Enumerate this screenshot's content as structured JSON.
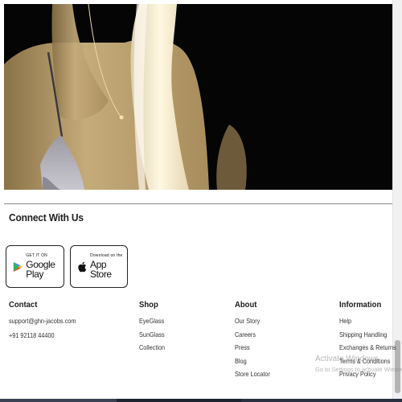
{
  "connect": {
    "title": "Connect With Us"
  },
  "badges": {
    "google": {
      "small": "GET IT ON",
      "big": "Google Play"
    },
    "apple": {
      "small": "Download on the",
      "big": "App Store"
    }
  },
  "footer": {
    "contact": {
      "heading": "Contact",
      "email": "support@ghn-jacobs.com",
      "phone": "+91 92118 44400"
    },
    "shop": {
      "heading": "Shop",
      "links": [
        "EyeGlass",
        "SunGlass",
        "Collection"
      ]
    },
    "about": {
      "heading": "About",
      "links": [
        "Our Story",
        "Careers",
        "Press",
        "Blog",
        "Store Locator"
      ]
    },
    "information": {
      "heading": "Information",
      "links": [
        "Help",
        "Shipping Handling",
        "Exchanges & Returns",
        "Terms & Conditions",
        "Privacy Policy"
      ]
    }
  },
  "watermark": {
    "title": "Activate Windows",
    "subtitle": "Go to Settings to activate Windows."
  },
  "colors": {
    "hero_background": "#050505",
    "text": "#222222",
    "divider": "#8a8a8a"
  }
}
